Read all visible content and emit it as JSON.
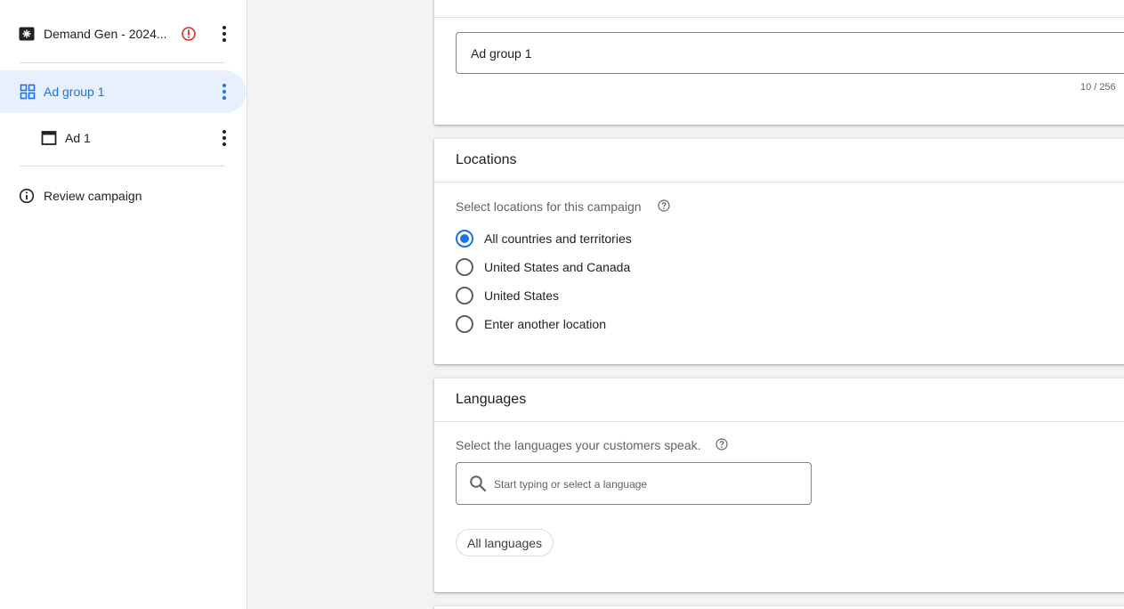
{
  "sidebar": {
    "campaign": {
      "label": "Demand Gen - 2024...",
      "status": "error"
    },
    "ad_group": {
      "label": "Ad group 1"
    },
    "ad": {
      "label": "Ad 1"
    },
    "review": {
      "label": "Review campaign"
    }
  },
  "ad_group_name": {
    "value": "Ad group 1",
    "counter": "10 / 256"
  },
  "locations": {
    "title": "Locations",
    "helper": "Select locations for this campaign",
    "options": [
      {
        "label": "All countries and territories",
        "selected": true
      },
      {
        "label": "United States and Canada",
        "selected": false
      },
      {
        "label": "United States",
        "selected": false
      },
      {
        "label": "Enter another location",
        "selected": false
      }
    ]
  },
  "languages": {
    "title": "Languages",
    "helper": "Select the languages your customers speak.",
    "placeholder": "Start typing or select a language",
    "chip": "All languages"
  },
  "colors": {
    "accent": "#1a73e8",
    "selected_bg": "#e8f0fe",
    "error": "#d93025"
  }
}
